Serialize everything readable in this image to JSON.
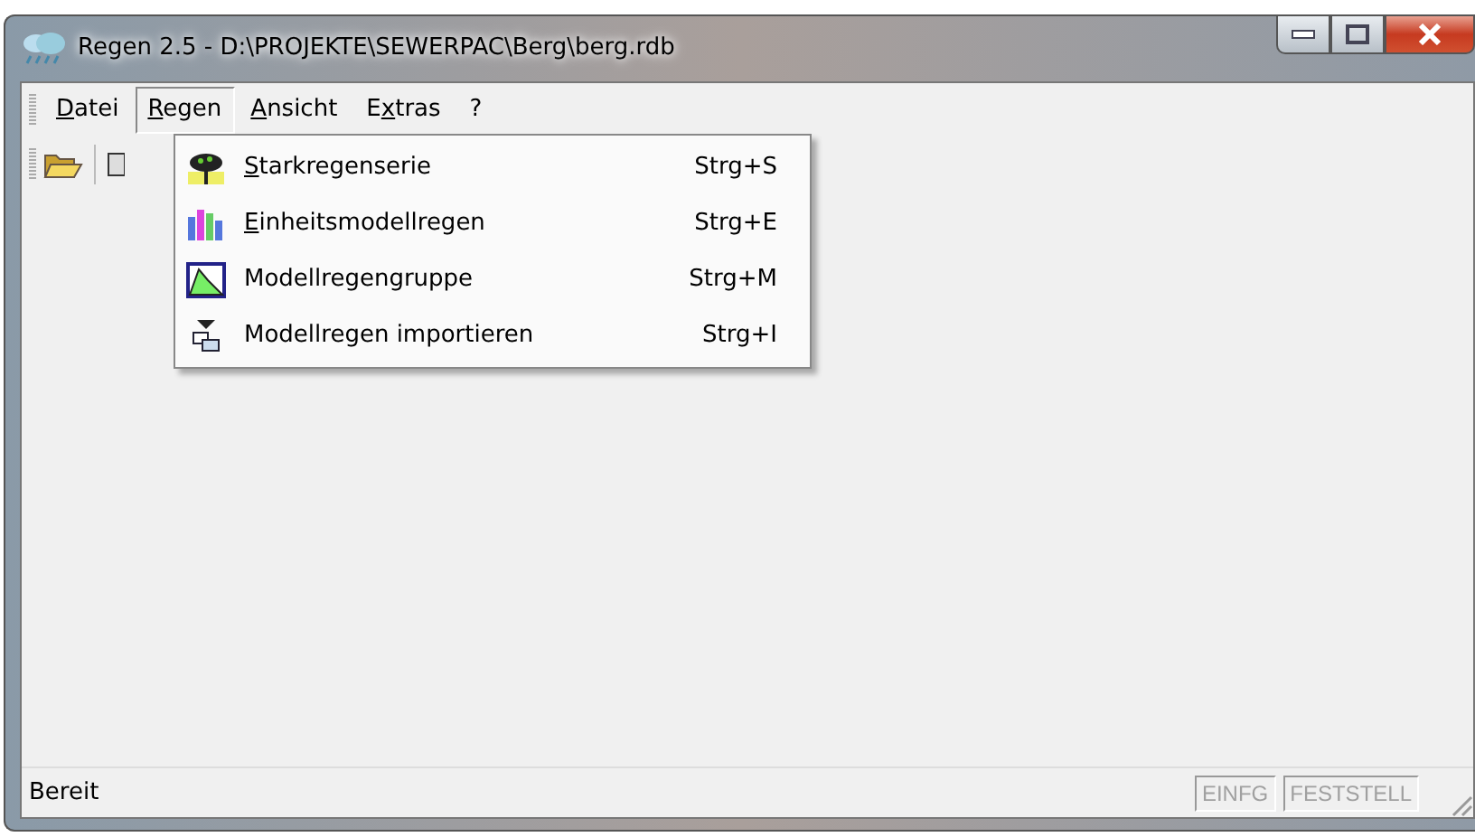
{
  "window": {
    "title": "Regen 2.5 - D:\\PROJEKTE\\SEWERPAC\\Berg\\berg.rdb"
  },
  "menu_bar": [
    {
      "key": "D",
      "post": "atei",
      "selected": false
    },
    {
      "key": "R",
      "post": "egen",
      "selected": true
    },
    {
      "key": "A",
      "post": "nsicht",
      "selected": false
    },
    {
      "pre": "E",
      "key": "x",
      "post": "tras",
      "selected": false
    },
    {
      "pre": "?",
      "selected": false
    }
  ],
  "open_menu": [
    {
      "key": "S",
      "post": "tarkregenserie",
      "shortcut": "Strg+S"
    },
    {
      "key": "E",
      "post": "inheitsmodellregen",
      "shortcut": "Strg+E"
    },
    {
      "pre": "Modellregengruppe",
      "shortcut": "Strg+M"
    },
    {
      "pre": "Modellregen importieren",
      "shortcut": "Strg+I"
    }
  ],
  "status_bar": {
    "text": "Bereit",
    "indicators": [
      {
        "label": "EINFG",
        "active": false
      },
      {
        "label": "FESTSTELL",
        "active": false
      }
    ]
  }
}
